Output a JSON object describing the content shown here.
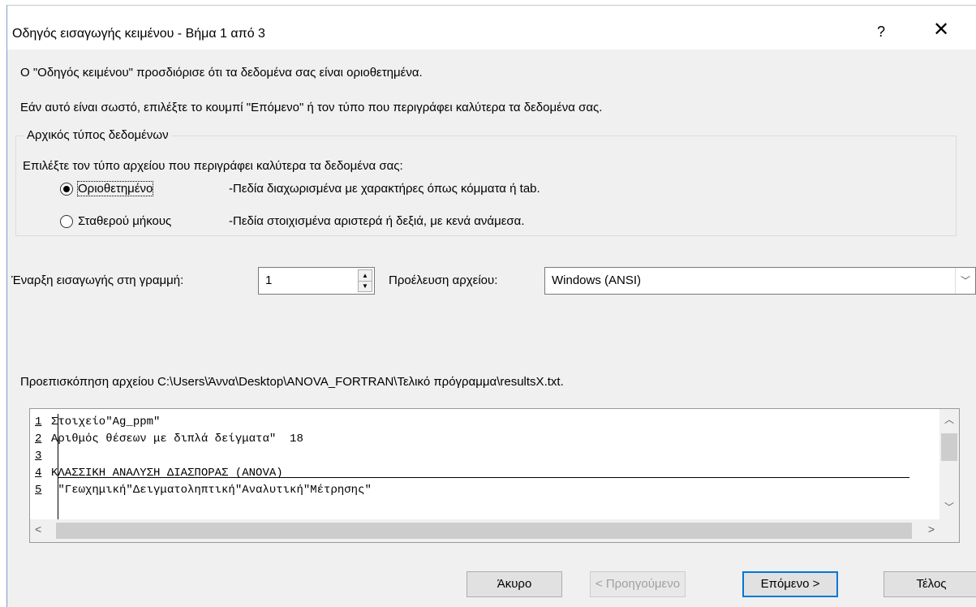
{
  "window": {
    "title": "Οδηγός εισαγωγής κειμένου - Βήμα 1 από 3",
    "help_glyph": "?",
    "close_glyph": "✕"
  },
  "intro": {
    "line1": "Ο \"Οδηγός κειμένου\" προσδιόρισε ότι τα δεδομένα σας είναι οριοθετημένα.",
    "line2": "Εάν αυτό είναι σωστό, επιλέξτε το κουμπί \"Επόμενο\" ή τον τύπο που περιγράφει καλύτερα τα δεδομένα σας."
  },
  "data_type_group": {
    "legend": "Αρχικός τύπος δεδομένων",
    "description": "Επιλέξτε τον τύπο αρχείου που περιγράφει καλύτερα τα δεδομένα σας:",
    "options": [
      {
        "label": "Οριοθετημένο",
        "description": "-Πεδία διαχωρισμένα με χαρακτήρες όπως κόμματα ή tab.",
        "selected": true
      },
      {
        "label": "Σταθερού μήκους",
        "description": "-Πεδία στοιχισμένα αριστερά ή δεξιά, με κενά ανάμεσα.",
        "selected": false
      }
    ]
  },
  "start_row": {
    "label": "Έναρξη εισαγωγής στη γραμμή:",
    "value": "1"
  },
  "file_origin": {
    "label": "Προέλευση αρχείου:",
    "value": "Windows (ANSI)"
  },
  "preview": {
    "label": "Προεπισκόπηση αρχείου C:\\Users\\Άννα\\Desktop\\ANOVA_FORTRAN\\Τελικό πρόγραμμα\\resultsX.txt.",
    "rows": [
      {
        "num": "1",
        "text": "Στοιχείο\"Ag_ppm\""
      },
      {
        "num": "2",
        "text": "Αριθμός θέσεων με διπλά δείγματα\"  18"
      },
      {
        "num": "3",
        "text": ""
      },
      {
        "num": "4",
        "text": "ΚΛΑΣΣΙΚΗ ΑΝΑΛΥΣΗ ΔΙΑΣΠΟΡΑΣ (ANOVA)"
      },
      {
        "num": "5",
        "text": " \"Γεωχημική\"Δειγματοληπτική\"Αναλυτική\"Μέτρησης\""
      }
    ]
  },
  "buttons": {
    "cancel": "Άκυρο",
    "previous": "< Προηγούμενο",
    "next": "Επόμενο >",
    "finish": "Τέλος"
  }
}
